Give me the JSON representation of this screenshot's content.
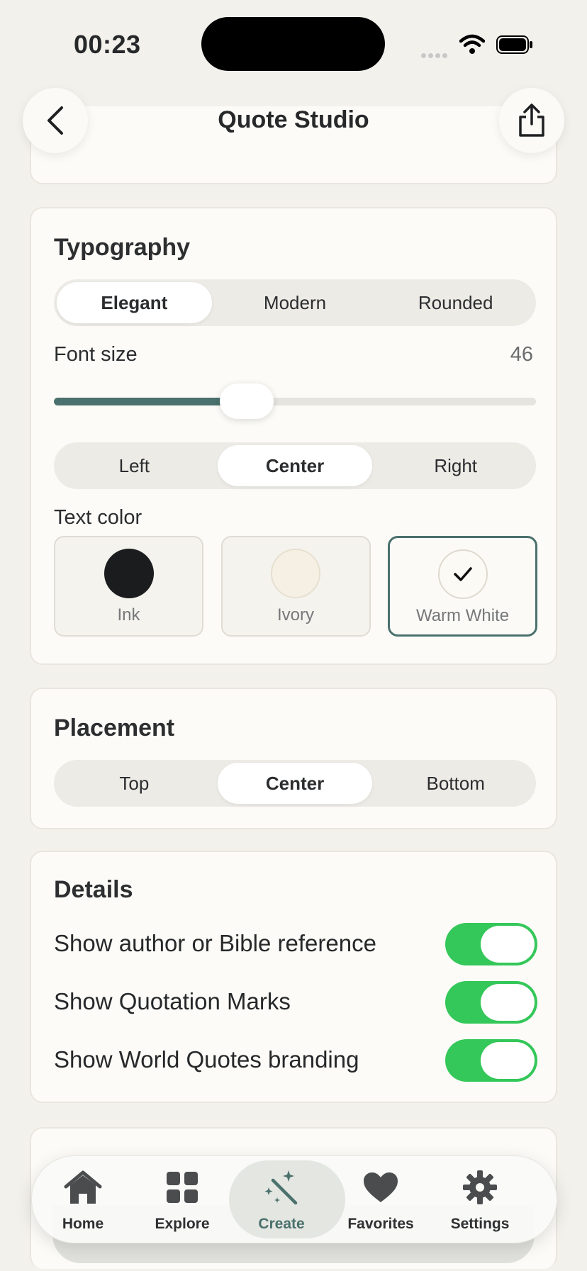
{
  "status": {
    "time": "00:23"
  },
  "header": {
    "title": "Quote Studio"
  },
  "typography": {
    "title": "Typography",
    "styles": [
      "Elegant",
      "Modern",
      "Rounded"
    ],
    "selected_style": "Elegant",
    "font_size_label": "Font size",
    "font_size_value": "46",
    "font_size_fraction": 0.4,
    "alignments": [
      "Left",
      "Center",
      "Right"
    ],
    "selected_alignment": "Center",
    "text_color_label": "Text color",
    "colors": [
      {
        "name": "Ink",
        "hex": "#1b1c1e"
      },
      {
        "name": "Ivory",
        "hex": "#f5f0e3"
      },
      {
        "name": "Warm White",
        "hex": "#fbfaf5"
      }
    ],
    "selected_color": "Warm White"
  },
  "placement": {
    "title": "Placement",
    "options": [
      "Top",
      "Center",
      "Bottom"
    ],
    "selected": "Center"
  },
  "details": {
    "title": "Details",
    "toggles": [
      {
        "label": "Show author or Bible reference",
        "on": true
      },
      {
        "label": "Show Quotation Marks",
        "on": true
      },
      {
        "label": "Show World Quotes branding",
        "on": true
      }
    ]
  },
  "tabbar": {
    "items": [
      "Home",
      "Explore",
      "Create",
      "Favorites",
      "Settings"
    ],
    "active": "Create"
  },
  "colors": {
    "accent": "#4a716d",
    "toggle_on": "#34c759",
    "background": "#f3f1ec"
  }
}
